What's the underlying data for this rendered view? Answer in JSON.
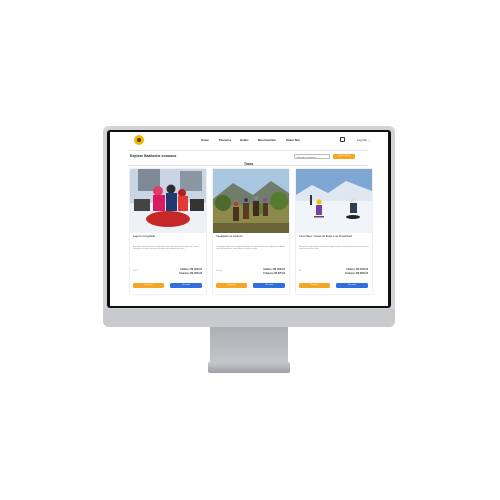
{
  "header": {
    "nav": [
      "Home",
      "Passeios",
      "Hotéis",
      "Meu Carrinho",
      "Sobre Nós"
    ],
    "logout": "Log Out ⌄"
  },
  "toolbar": {
    "title": "Explore Bariloche conosco",
    "select_value": "Selecione categoria ⌄",
    "clear_label": "Limpar filtros"
  },
  "section": {
    "title": "Tours"
  },
  "cards": [
    {
      "title": "Laguna Congelada",
      "description": "A grande tirolesa de palavra, cada uma turista conta das mais atrações do inverno, aproveite e viva dias com sorte diversão, que também para você.",
      "duration": "4h30",
      "price_adult": "Adultos: R$ 1000,00",
      "price_child": "Crianças: R$ 1250,00",
      "buy_label": "Reservar",
      "more_label": "Ver mais"
    },
    {
      "title": "Cavalgada na estância",
      "description": "Cavalgada rústica com paisagem de Bariloche, tudo próximo da Cordilheira dos Andes, num final agradável, com passeio e lanche incluído.",
      "duration": "4h serv.",
      "price_adult": "Adultos: R$ 1000,00",
      "price_child": "Crianças: R$ 870,00",
      "buy_label": "Reservar",
      "more_label": "Ver mais"
    },
    {
      "title": "Cerro Bayo: Classe de Esqui e de Snowboard",
      "description": "Estação de esqui ideal para iniciantes e para famílias, com aulas para todos os níveis e vistas incríveis da região.",
      "duration": "8h",
      "price_adult": "Adultos: R$ 4100,00",
      "price_child": "Crianças: R$ 3000,00",
      "buy_label": "Reservar",
      "more_label": "Ver mais"
    }
  ]
}
